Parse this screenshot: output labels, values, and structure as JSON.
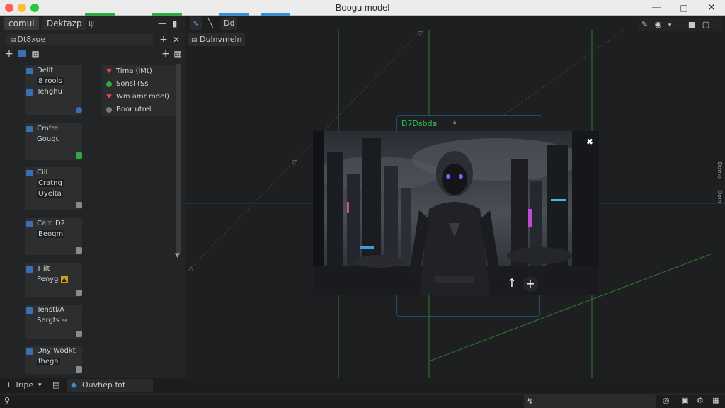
{
  "window": {
    "title": "Boogu model"
  },
  "left_panel": {
    "tabs": [
      {
        "label": "comui"
      },
      {
        "label": "Dektazp"
      }
    ],
    "search_value": "Dt8xoe",
    "nodes": [
      {
        "lines": [
          "Dellt",
          "8 rools",
          "Tehghu"
        ],
        "dot_color": "#3a6fb0"
      },
      {
        "lines": [
          "Cmfre",
          "Gougu"
        ],
        "dot_color": "#2fa845"
      },
      {
        "lines": [
          "Cill",
          "Cratng",
          "Oyelta"
        ],
        "dot_color": "#8a8a8a"
      },
      {
        "lines": [
          "Cam D2",
          "Beogm"
        ],
        "dot_color": "#8a8a8a"
      },
      {
        "lines": [
          "Tlilt",
          "Penyg"
        ],
        "dot_color": "#8a8a8a"
      },
      {
        "lines": [
          "Tenstl/A",
          "Sergts"
        ],
        "dot_color": "#8a8a8a"
      },
      {
        "lines": [
          "Dny Wodkt",
          "fhega"
        ],
        "dot_color": "#8a8a8a"
      }
    ],
    "properties": [
      {
        "label": "Tima (lMt)",
        "mark": "heart",
        "color": "#e04848"
      },
      {
        "label": "Sonsl (Ss",
        "mark": "dot",
        "color": "#2fa845"
      },
      {
        "label": "Wm amr mdel)",
        "mark": "heart",
        "color": "#e04848"
      },
      {
        "label": "Boor utrel",
        "mark": "dot",
        "color": "#7a7a7a"
      }
    ]
  },
  "canvas": {
    "tabs": [
      {
        "label": "Dd"
      }
    ],
    "breadcrumb": "Dulnvmeln",
    "group_label": "D7Dsbda",
    "preview_alt": "cyberpunk character preview"
  },
  "bottom_bar": {
    "add_label": "+ Tripe",
    "output_label": "Ouvhep fot"
  },
  "right_labels": [
    "Ddmo",
    "Dom"
  ],
  "colors": {
    "accent_green": "#27c25a",
    "accent_blue": "#3a6fb0",
    "group_border": "#27486b"
  }
}
